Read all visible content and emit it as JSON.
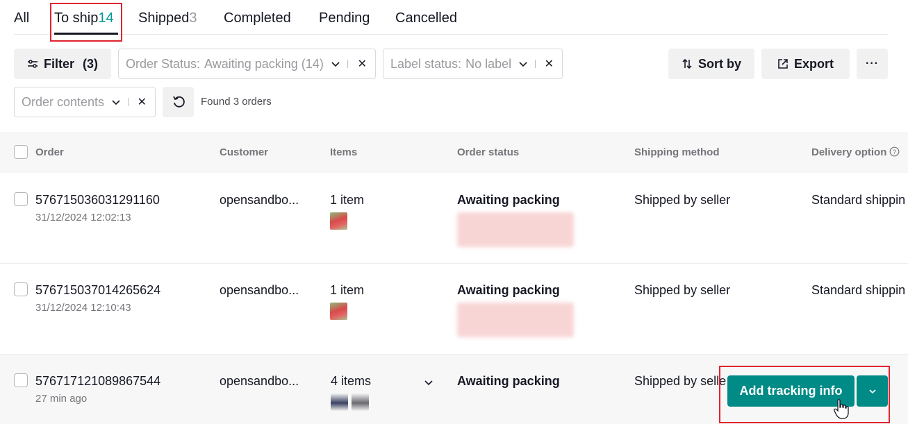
{
  "tabs": [
    {
      "label": "All",
      "count": ""
    },
    {
      "label": "To ship",
      "count": "14"
    },
    {
      "label": "Shipped",
      "count": "3"
    },
    {
      "label": "Completed",
      "count": ""
    },
    {
      "label": "Pending",
      "count": ""
    },
    {
      "label": "Cancelled",
      "count": ""
    }
  ],
  "active_tab": "To ship",
  "toolbar": {
    "filter_label": "Filter",
    "filter_count": "(3)",
    "sort_label": "Sort by",
    "export_label": "Export",
    "more_label": "···"
  },
  "filters": {
    "order_status": {
      "key": "Order Status:",
      "value": "Awaiting packing (14)"
    },
    "label_status": {
      "key": "Label status:",
      "value": "No label"
    },
    "order_contents": {
      "key": "Order contents",
      "value": ""
    },
    "found_text": "Found 3 orders"
  },
  "columns": [
    "Order",
    "Customer",
    "Items",
    "Order status",
    "Shipping method",
    "Delivery option"
  ],
  "orders": [
    {
      "id": "576715036031291160",
      "time": "31/12/2024 12:02:13",
      "customer": "opensandbo...",
      "items": "1 item",
      "status": "Awaiting packing",
      "shipping": "Shipped by seller",
      "delivery": "Standard shippin"
    },
    {
      "id": "576715037014265624",
      "time": "31/12/2024 12:10:43",
      "customer": "opensandbo...",
      "items": "1 item",
      "status": "Awaiting packing",
      "shipping": "Shipped by seller",
      "delivery": "Standard shippin"
    },
    {
      "id": "576717121089867544",
      "time": "27 min ago",
      "customer": "opensandbo...",
      "items": "4 items",
      "status": "Awaiting packing",
      "shipping": "Shipped by selle",
      "delivery": ""
    }
  ],
  "actions": {
    "add_tracking_label": "Add tracking info"
  },
  "colors": {
    "accent": "#009995",
    "button": "#008b86",
    "highlight": "#e0242e"
  }
}
